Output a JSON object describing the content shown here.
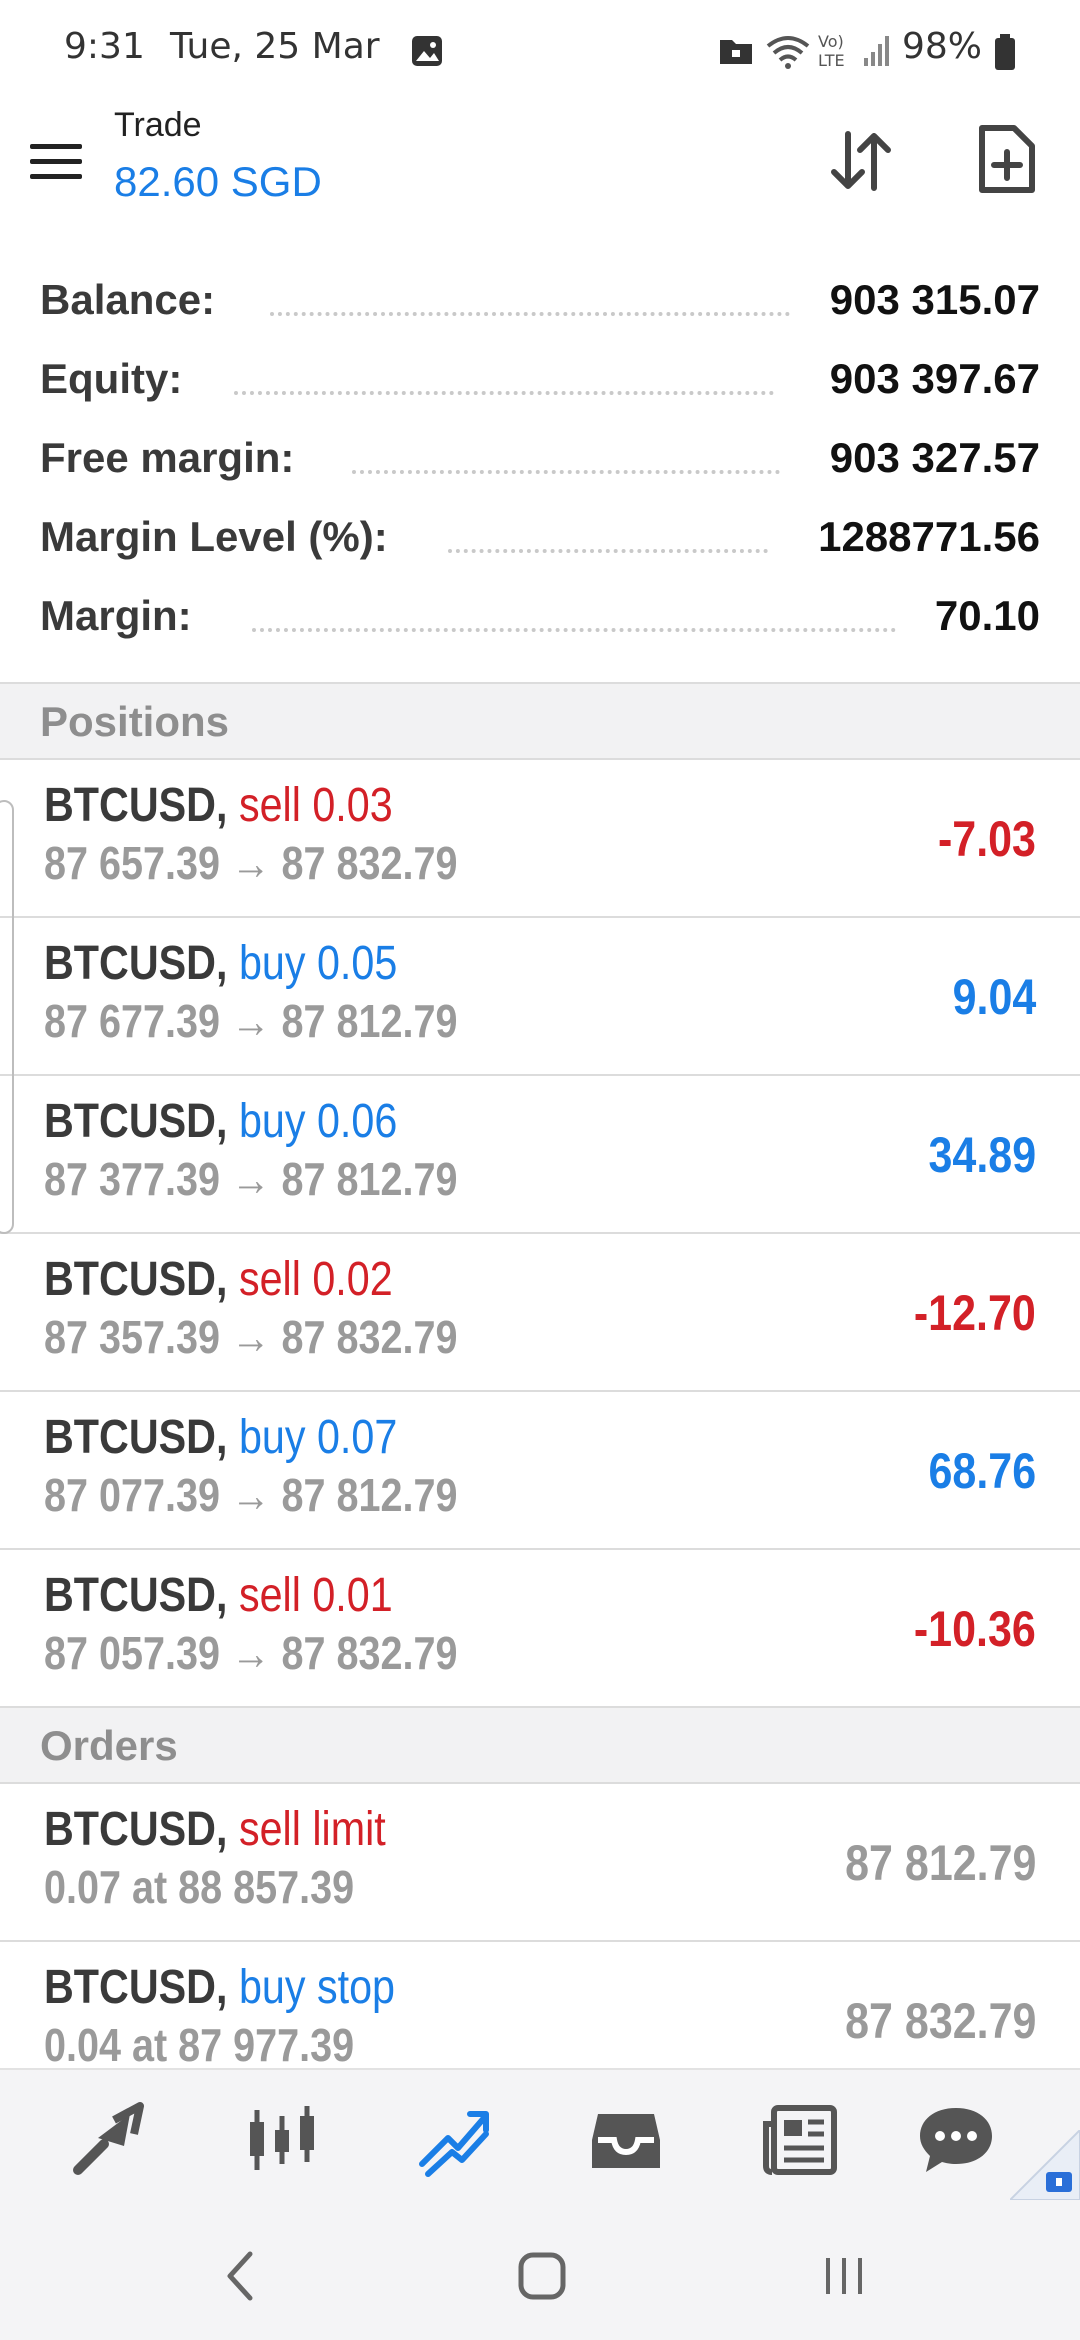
{
  "status_bar": {
    "time": "9:31",
    "date": "Tue, 25 Mar",
    "battery": "98%",
    "icons": [
      "image-icon",
      "folder-lock-icon",
      "wifi-icon",
      "volte-icon",
      "signal-icon",
      "battery-icon"
    ]
  },
  "header": {
    "title": "Trade",
    "value": "82.60 SGD",
    "icons": [
      "menu-icon",
      "sort-arrows-icon",
      "new-order-icon"
    ]
  },
  "summary": [
    {
      "label": "Balance:",
      "value": "903 315.07"
    },
    {
      "label": "Equity:",
      "value": "903 397.67"
    },
    {
      "label": "Free margin:",
      "value": "903 327.57"
    },
    {
      "label": "Margin Level (%):",
      "value": "1288771.56"
    },
    {
      "label": "Margin:",
      "value": "70.10"
    }
  ],
  "positions_header": "Positions",
  "positions": [
    {
      "symbol": "BTCUSD,",
      "action": "sell 0.03",
      "prices": "87 657.39 → 87 832.79",
      "profit": "-7.03"
    },
    {
      "symbol": "BTCUSD,",
      "action": "buy 0.05",
      "prices": "87 677.39 → 87 812.79",
      "profit": "9.04"
    },
    {
      "symbol": "BTCUSD,",
      "action": "buy 0.06",
      "prices": "87 377.39 → 87 812.79",
      "profit": "34.89"
    },
    {
      "symbol": "BTCUSD,",
      "action": "sell 0.02",
      "prices": "87 357.39 → 87 832.79",
      "profit": "-12.70"
    },
    {
      "symbol": "BTCUSD,",
      "action": "buy 0.07",
      "prices": "87 077.39 → 87 812.79",
      "profit": "68.76"
    },
    {
      "symbol": "BTCUSD,",
      "action": "sell 0.01",
      "prices": "87 057.39 → 87 832.79",
      "profit": "-10.36"
    }
  ],
  "orders_header": "Orders",
  "orders": [
    {
      "symbol": "BTCUSD,",
      "action": "sell limit",
      "details": "0.07 at 88 857.39",
      "price": "87 812.79"
    },
    {
      "symbol": "BTCUSD,",
      "action": "buy stop",
      "details": "0.04 at 87 977.39",
      "price": "87 832.79"
    }
  ],
  "bottom_nav": [
    "quotes-icon",
    "chart-icon",
    "trade-icon",
    "history-icon",
    "news-icon",
    "messages-icon"
  ],
  "colors": {
    "accent": "#1a7ee6",
    "sell": "#d32027",
    "muted": "#9a9a9a"
  }
}
